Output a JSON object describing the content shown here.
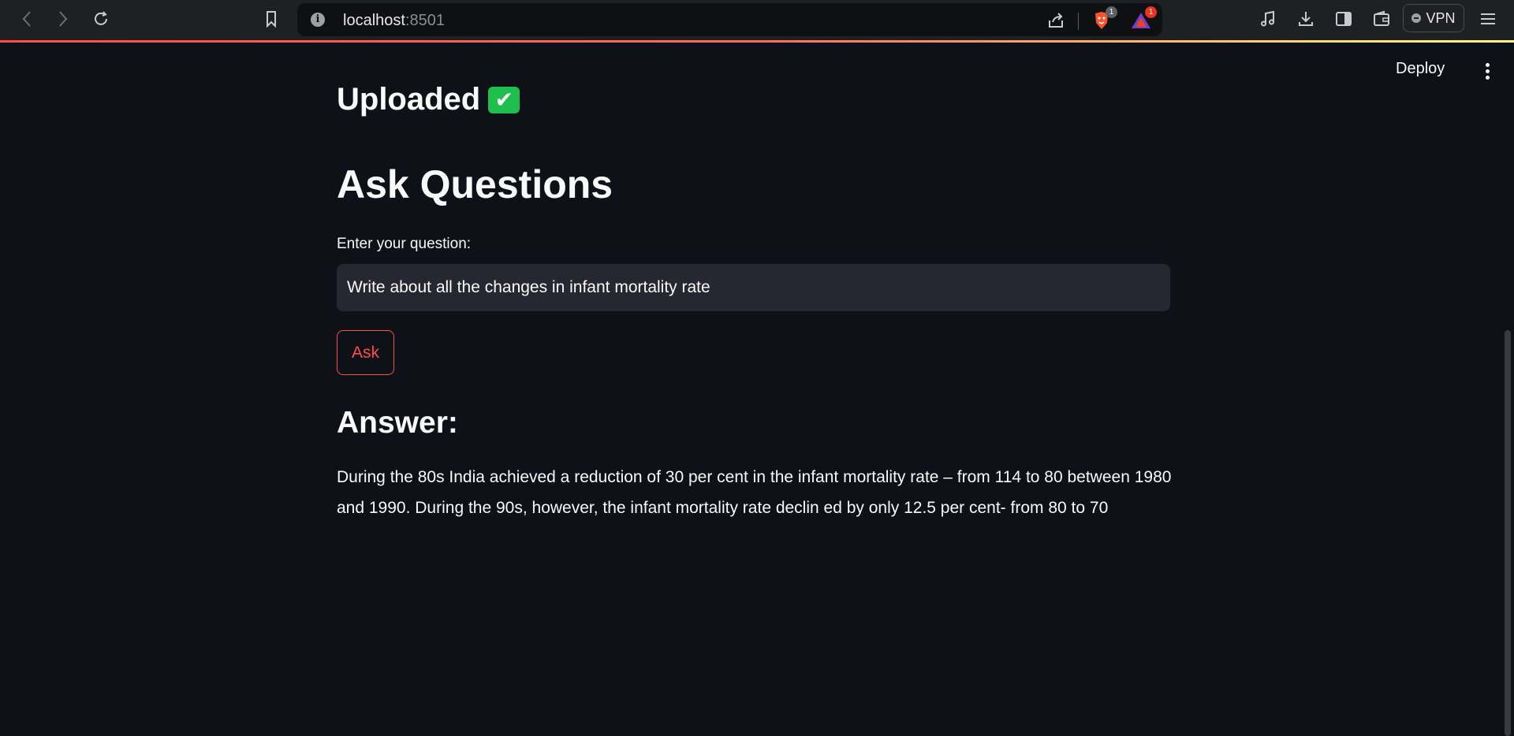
{
  "browser": {
    "url_host": "localhost",
    "url_port": ":8501",
    "brave_badge": "1",
    "rewards_badge": "1",
    "vpn_label": "VPN"
  },
  "app": {
    "deploy_label": "Deploy",
    "uploaded_heading": "Uploaded",
    "uploaded_emoji": "✔",
    "ask_heading": "Ask Questions",
    "question_label": "Enter your question:",
    "question_value": "Write about all the changes in infant mortality rate",
    "ask_button_label": "Ask",
    "answer_heading": "Answer:",
    "answer_text": "During the 80s India achieved a reduction of 30 per cent in the infant mortality rate – from 114 to 80 between 1980 and 1990. During the 90s, however, the infant mortality rate declin ed by only 12.5 per cent- from 80 to 70"
  },
  "colors": {
    "background": "#0e1117",
    "accent": "#ff4b4b",
    "input_bg": "#262730",
    "success": "#1fbf4e"
  },
  "icons": [
    "back-icon",
    "forward-icon",
    "reload-icon",
    "bookmark-icon",
    "info-icon",
    "share-icon",
    "brave-shields-icon",
    "brave-rewards-icon",
    "media-icon",
    "download-icon",
    "sidebar-icon",
    "wallet-icon",
    "vpn-icon",
    "menu-icon",
    "more-vert-icon",
    "check-mark-icon"
  ]
}
